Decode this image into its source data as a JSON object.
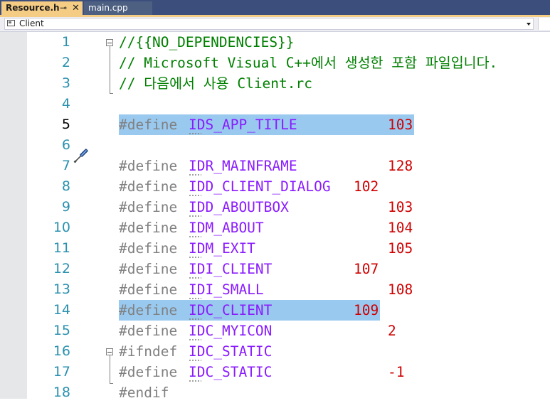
{
  "tabs": [
    {
      "label": "Resource.h",
      "active": true
    },
    {
      "label": "main.cpp",
      "active": false
    }
  ],
  "tab_icons": {
    "pin": "pin-icon",
    "close": "close-icon"
  },
  "navbar": {
    "project": "Client",
    "project_icon": "project-icon",
    "dropdown_icon": "chevron-down-icon"
  },
  "colors": {
    "comment": "#008000",
    "preprocessor": "#808080",
    "macro": "#8a1bff",
    "number": "#d00000",
    "highlight": "#99c9ef",
    "line_number": "#2b91af",
    "active_tab": "#f5cc84"
  },
  "editor": {
    "lines": [
      {
        "n": "1",
        "comment": "//{{NO_DEPENDENCIES}}"
      },
      {
        "n": "2",
        "comment": "// Microsoft Visual C++에서 생성한 포함 파일입니다."
      },
      {
        "n": "3",
        "comment": "// 다음에서 사용 Client.rc"
      },
      {
        "n": "4"
      },
      {
        "n": "5",
        "pre": "#define",
        "macro": "IDS_APP_TITLE",
        "value": "103",
        "highlight": true,
        "current": true,
        "quick_action_icon": "screwdriver-icon"
      },
      {
        "n": "6"
      },
      {
        "n": "7",
        "pre": "#define",
        "macro": "IDR_MAINFRAME",
        "value": "128"
      },
      {
        "n": "8",
        "pre": "#define",
        "macro": "IDD_CLIENT_DIALOG",
        "value": "102"
      },
      {
        "n": "9",
        "pre": "#define",
        "macro": "IDD_ABOUTBOX",
        "value": "103"
      },
      {
        "n": "10",
        "pre": "#define",
        "macro": "IDM_ABOUT",
        "value": "104"
      },
      {
        "n": "11",
        "pre": "#define",
        "macro": "IDM_EXIT",
        "value": "105"
      },
      {
        "n": "12",
        "pre": "#define",
        "macro": "IDI_CLIENT",
        "value": "107"
      },
      {
        "n": "13",
        "pre": "#define",
        "macro": "IDI_SMALL",
        "value": "108"
      },
      {
        "n": "14",
        "pre": "#define",
        "macro": "IDC_CLIENT",
        "value": "109",
        "highlight": true
      },
      {
        "n": "15",
        "pre": "#define",
        "macro": "IDC_MYICON",
        "value": "2"
      },
      {
        "n": "16",
        "pre": "#ifndef",
        "macro": "IDC_STATIC"
      },
      {
        "n": "17",
        "pre": "#define",
        "macro": "IDC_STATIC",
        "value": "-1"
      },
      {
        "n": "18",
        "pre": "#endif"
      }
    ]
  }
}
